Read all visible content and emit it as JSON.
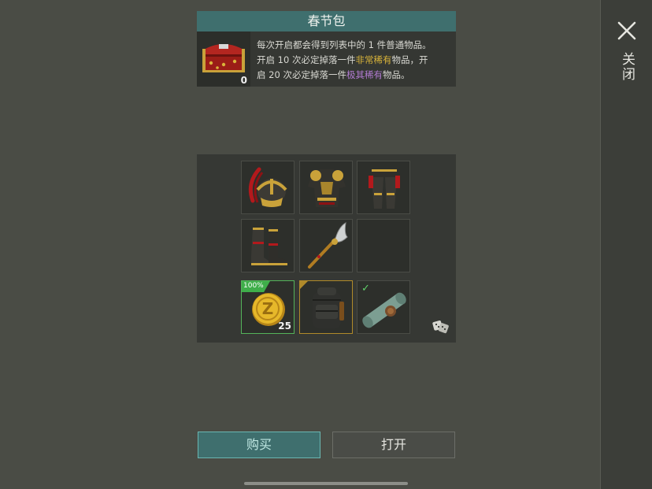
{
  "dialog": {
    "title": "春节包",
    "chest_count": "0",
    "description_parts": {
      "line1": "每次开启都会得到列表中的 1 件普通物品。",
      "line2_pre": "开启 10 次必定掉落一件",
      "rarity_rare": "非常稀有",
      "line2_post": "物品，开",
      "line3_pre": "启 20 次必定掉落一件",
      "rarity_epic": "极其稀有",
      "line3_post": "物品。"
    },
    "colors": {
      "rare": "#d9b43a",
      "epic": "#b07ad0",
      "accent": "#3f6f6e"
    }
  },
  "items": [
    {
      "icon": "plumed-helmet-icon"
    },
    {
      "icon": "ornate-armor-icon"
    },
    {
      "icon": "armored-pants-icon"
    },
    {
      "icon": "armored-boots-icon"
    },
    {
      "icon": "guandao-glaive-icon"
    },
    {
      "icon": "empty-slot"
    },
    {
      "icon": "gold-coin-icon",
      "badge": "100%",
      "count": "25"
    },
    {
      "icon": "backpack-icon"
    },
    {
      "icon": "scroll-map-icon",
      "checked": true
    }
  ],
  "buttons": {
    "buy": "购买",
    "open": "打开"
  },
  "sidebar": {
    "close_label": "关闭"
  }
}
